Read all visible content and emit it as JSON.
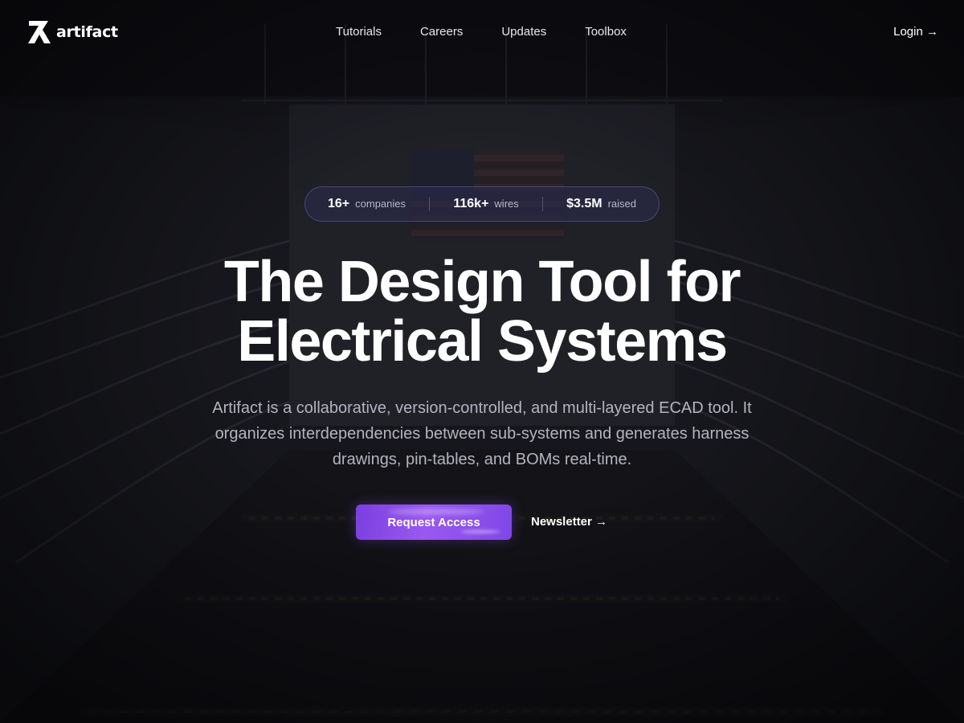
{
  "brand": {
    "name": "artifact",
    "logo_icon": "artifact-logo-icon"
  },
  "nav": {
    "links": [
      {
        "label": "Tutorials"
      },
      {
        "label": "Careers"
      },
      {
        "label": "Updates"
      },
      {
        "label": "Toolbox"
      }
    ],
    "login_label": "Login →"
  },
  "stats": [
    {
      "value": "16+",
      "label": "companies"
    },
    {
      "value": "116k+",
      "label": "wires"
    },
    {
      "value": "$3.5M",
      "label": "raised"
    }
  ],
  "hero": {
    "headline_line1": "The Design Tool for",
    "headline_line2": "Electrical Systems",
    "description": "Artifact is a collaborative, version-controlled, and multi-layered ECAD tool. It organizes interdependencies between sub-systems and generates harness drawings, pin-tables, and BOMs real-time."
  },
  "cta": {
    "primary_label": "Request Access",
    "secondary_label": "Newsletter →"
  },
  "colors": {
    "accent": "#8b4ef0",
    "background": "#141418",
    "text_muted": "#b4b4c0"
  }
}
